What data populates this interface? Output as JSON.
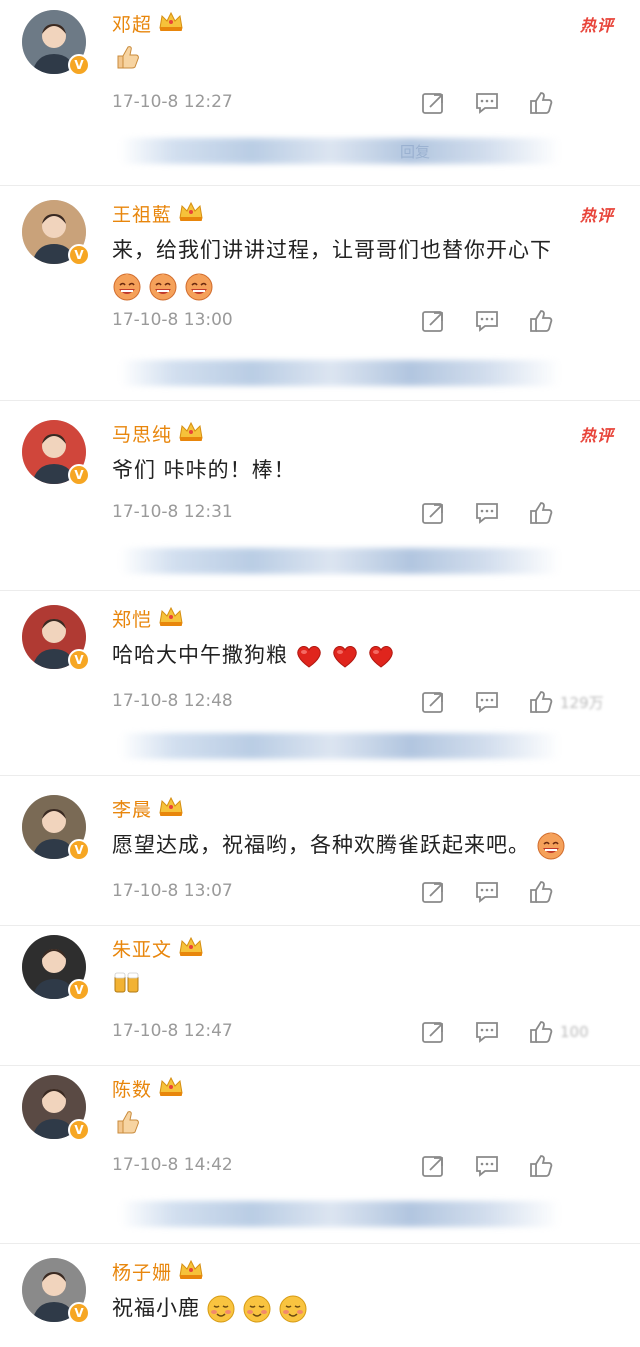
{
  "comments": [
    {
      "id": "deng-chao",
      "name": "邓超",
      "text": "",
      "emojis": [
        "thumbs-up"
      ],
      "timestamp": "17-10-8 12:27",
      "hot": "热评",
      "likes": "",
      "replies": "回复",
      "avatar_color": "#6d7a86"
    },
    {
      "id": "wang-zulan",
      "name": "王祖藍",
      "text": "来，给我们讲讲过程，让哥哥们也替你开心下",
      "emojis": [
        "laugh",
        "laugh",
        "laugh"
      ],
      "timestamp": "17-10-8 13:00",
      "hot": "热评",
      "likes": "",
      "replies": "",
      "avatar_color": "#c9a27a"
    },
    {
      "id": "ma-sichun",
      "name": "马思纯",
      "text": "爷们 咔咔的！棒！",
      "emojis": [],
      "timestamp": "17-10-8 12:31",
      "hot": "热评",
      "likes": "",
      "replies": "",
      "avatar_color": "#d0463b"
    },
    {
      "id": "zheng-kai",
      "name": "郑恺",
      "text": "哈哈大中午撒狗粮",
      "emojis": [
        "heart",
        "heart",
        "heart"
      ],
      "timestamp": "17-10-8 12:48",
      "hot": "",
      "likes": "129万",
      "replies": "",
      "avatar_color": "#b03a33"
    },
    {
      "id": "li-chen",
      "name": "李晨",
      "text": "愿望达成，祝福哟，各种欢腾雀跃起来吧。",
      "emojis": [
        "laugh"
      ],
      "timestamp": "17-10-8 13:07",
      "hot": "",
      "likes": "",
      "replies": "",
      "avatar_color": "#7a6a55"
    },
    {
      "id": "zhu-yawen",
      "name": "朱亚文",
      "text": "",
      "emojis": [
        "beer"
      ],
      "timestamp": "17-10-8 12:47",
      "hot": "",
      "likes": "100",
      "replies": "",
      "avatar_color": "#2e2e2e"
    },
    {
      "id": "chen-shu",
      "name": "陈数",
      "text": "",
      "emojis": [
        "thumbs-up"
      ],
      "timestamp": "17-10-8 14:42",
      "hot": "",
      "likes": "",
      "replies": "",
      "avatar_color": "#5a4a44"
    },
    {
      "id": "yang-zishan",
      "name": "杨子姗",
      "text": "祝福小鹿",
      "emojis": [
        "blush",
        "blush",
        "blush"
      ],
      "timestamp": "",
      "hot": "",
      "likes": "",
      "replies": "",
      "avatar_color": "#8a8a8a"
    }
  ],
  "colors": {
    "name": "#e8860c",
    "hot": "#e8443a",
    "verified": "#f6a623",
    "meta": "#9a9a9a"
  },
  "icons": {
    "verified": "V",
    "crown": "crown-icon",
    "repost": "share-icon",
    "comment": "comment-icon",
    "like": "like-icon"
  }
}
